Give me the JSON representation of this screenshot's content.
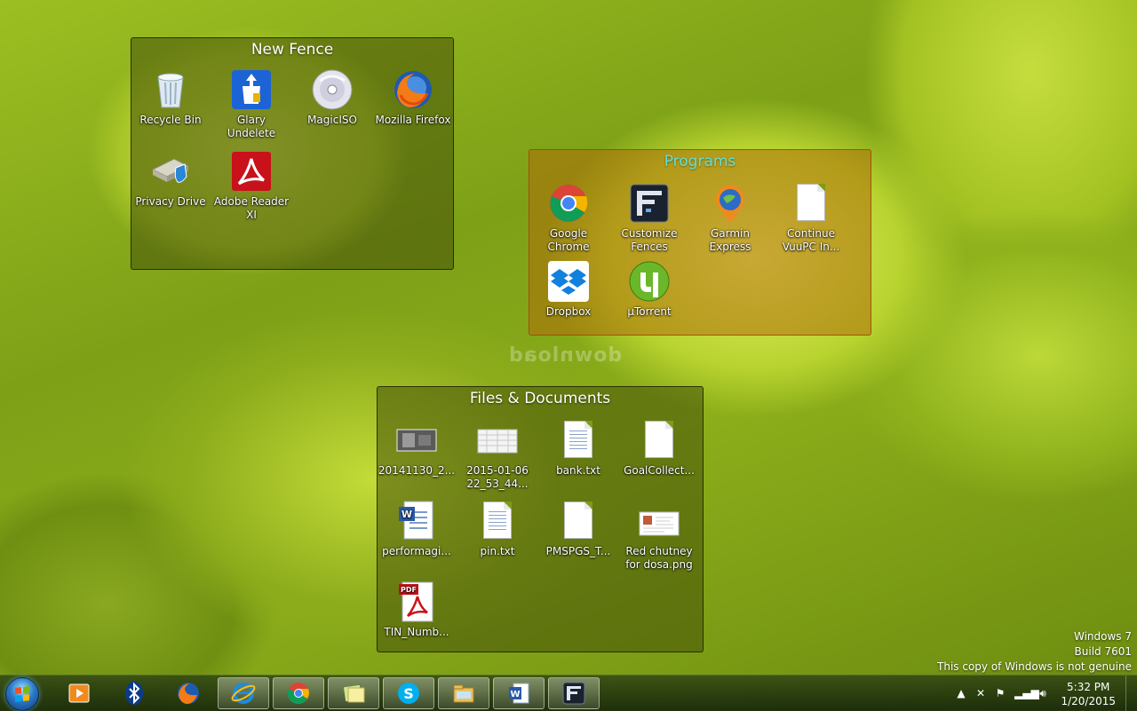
{
  "watermark": "download",
  "fences": {
    "new_fence": {
      "title": "New Fence",
      "items": [
        {
          "label": "Recycle Bin",
          "icon": "recycle-bin-icon"
        },
        {
          "label": "Glary Undelete",
          "icon": "glary-undelete-icon"
        },
        {
          "label": "MagicISO",
          "icon": "magiciso-icon"
        },
        {
          "label": "Mozilla Firefox",
          "icon": "firefox-icon"
        },
        {
          "label": "Privacy Drive",
          "icon": "privacy-drive-icon"
        },
        {
          "label": "Adobe Reader XI",
          "icon": "adobe-reader-icon"
        }
      ]
    },
    "programs": {
      "title": "Programs",
      "items": [
        {
          "label": "Google Chrome",
          "icon": "chrome-icon"
        },
        {
          "label": "Customize Fences",
          "icon": "fences-icon"
        },
        {
          "label": "Garmin Express",
          "icon": "garmin-icon"
        },
        {
          "label": "Continue VuuPC In...",
          "icon": "blank-document-icon"
        },
        {
          "label": "Dropbox",
          "icon": "dropbox-icon"
        },
        {
          "label": "µTorrent",
          "icon": "utorrent-icon"
        }
      ]
    },
    "files": {
      "title": "Files & Documents",
      "items": [
        {
          "label": "20141130_2...",
          "icon": "image-file-icon"
        },
        {
          "label": "2015-01-06 22_53_44...",
          "icon": "spreadsheet-image-icon"
        },
        {
          "label": "bank.txt",
          "icon": "text-file-icon"
        },
        {
          "label": "GoalCollect...",
          "icon": "blank-document-icon"
        },
        {
          "label": "performagi...",
          "icon": "word-document-icon"
        },
        {
          "label": "pin.txt",
          "icon": "text-file-icon"
        },
        {
          "label": "PMSPGS_T...",
          "icon": "blank-document-icon"
        },
        {
          "label": "Red chutney for dosa.png",
          "icon": "image-file-icon"
        },
        {
          "label": "TIN_Numb...",
          "icon": "pdf-file-icon"
        }
      ]
    }
  },
  "genuine_notice": {
    "line1": "Windows 7",
    "line2": "Build 7601",
    "line3": "This copy of Windows is not genuine"
  },
  "taskbar": {
    "pinned": [
      {
        "name": "media-center-icon"
      },
      {
        "name": "bluetooth-icon"
      },
      {
        "name": "firefox-icon"
      },
      {
        "name": "internet-explorer-icon"
      },
      {
        "name": "chrome-icon"
      },
      {
        "name": "sticky-notes-icon"
      },
      {
        "name": "skype-icon"
      },
      {
        "name": "file-explorer-icon"
      },
      {
        "name": "word-icon"
      },
      {
        "name": "fences-icon"
      }
    ],
    "clock": {
      "time": "5:32 PM",
      "date": "1/20/2015"
    }
  }
}
